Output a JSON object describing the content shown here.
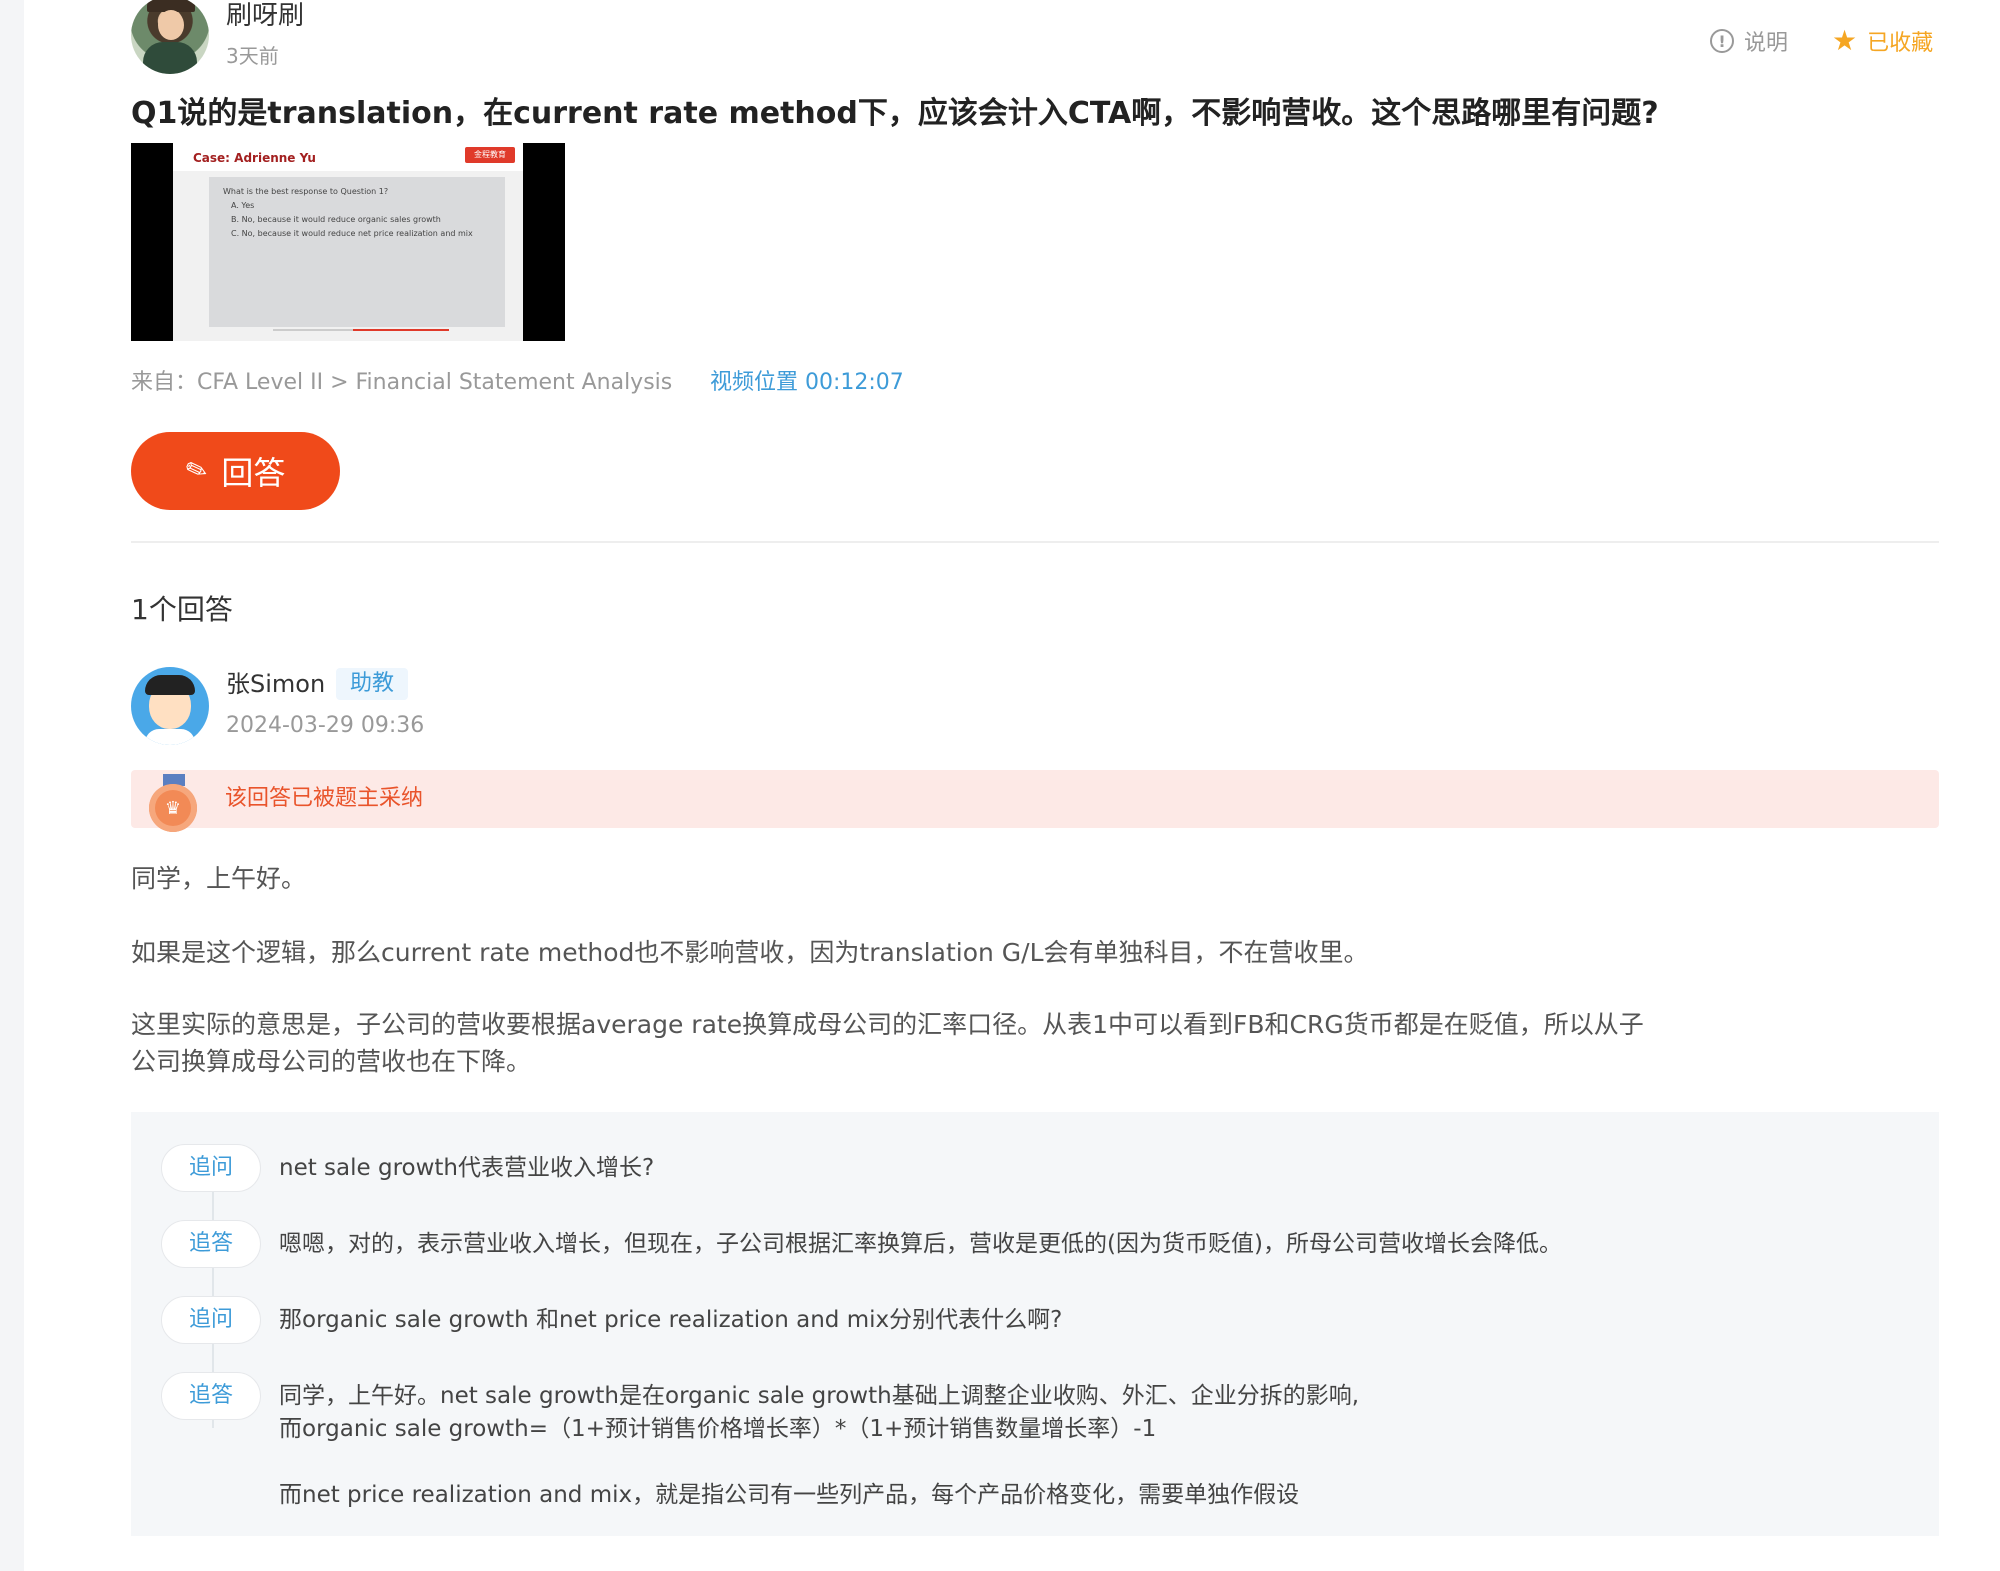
{
  "question": {
    "asker_name": "刷呀刷",
    "asker_time": "3天前",
    "explain_label": "说明",
    "favorite_label": "已收藏",
    "title": "Q1说的是translation，在current rate method下，应该会计入CTA啊，不影响营收。这个思路哪里有问题?",
    "thumbnail": {
      "slide_title": "Case: Adrienne Yu",
      "slide_logo": "金程教育",
      "lines": [
        "What is the best response to Question 1?",
        "A. Yes",
        "B. No, because it would reduce organic sales growth",
        "C. No, because it would reduce net price realization and mix"
      ]
    },
    "source": "来自：CFA Level II > Financial Statement Analysis",
    "video_position": "视频位置 00:12:07",
    "answer_button": "回答"
  },
  "answers_count": "1个回答",
  "answer": {
    "name": "张Simon",
    "badge": "助教",
    "time": "2024-03-29 09:36",
    "adopted_text": "该回答已被题主采纳",
    "paragraphs": [
      "同学，上午好。",
      "如果是这个逻辑，那么current rate method也不影响营收，因为translation G/L会有单独科目，不在营收里。",
      "这里实际的意思是，子公司的营收要根据average rate换算成母公司的汇率口径。从表1中可以看到FB和CRG货币都是在贬值，所以从子",
      "公司换算成母公司的营收也在下降。"
    ]
  },
  "followups": [
    {
      "tag": "追问",
      "lines": [
        "net sale growth代表营业收入增长?"
      ]
    },
    {
      "tag": "追答",
      "lines": [
        "嗯嗯，对的，表示营业收入增长，但现在，子公司根据汇率换算后，营收是更低的(因为货币贬值)，所母公司营收增长会降低。"
      ]
    },
    {
      "tag": "追问",
      "lines": [
        "那organic sale growth 和net price realization and mix分别代表什么啊?"
      ]
    },
    {
      "tag": "追答",
      "lines": [
        "同学，上午好。net sale growth是在organic sale growth基础上调整企业收购、外汇、企业分拆的影响,",
        "而organic sale growth=（1+预计销售价格增长率）*（1+预计销售数量增长率）-1",
        "而net price realization and mix，就是指公司有一些列产品，每个产品价格变化，需要单独作假设"
      ]
    }
  ],
  "colors": {
    "accent_orange": "#f04a1a",
    "link_blue": "#3d9bd8",
    "favorite": "#f5a623",
    "adopted_bg": "#fde9e6"
  },
  "icons": [
    "explain-icon",
    "star-icon",
    "pencil-icon",
    "medal-icon"
  ]
}
